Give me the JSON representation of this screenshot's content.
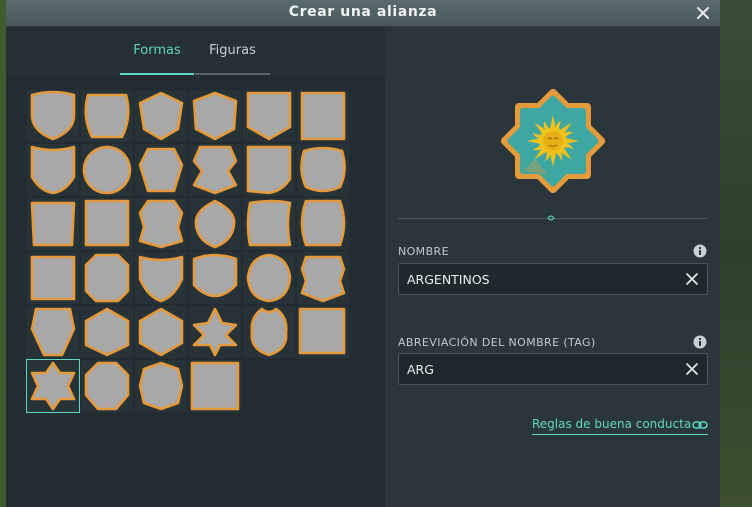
{
  "window": {
    "title": "Crear una alianza"
  },
  "tabs": [
    {
      "label": "Formas",
      "active": true
    },
    {
      "label": "Figuras",
      "active": false
    }
  ],
  "shapes": {
    "count": 34,
    "selected_index": 30,
    "rows": 6,
    "columns": 6
  },
  "emblem": {
    "name": "sun-star-emblem",
    "colors": {
      "border": "#e59a3b",
      "fill": "#3fa7a1",
      "sun": "#f1c21d"
    }
  },
  "form": {
    "name_label": "NOMBRE",
    "name_value": "ARGENTINOS",
    "tag_label": "ABREVIACIÓN DEL NOMBRE (TAG)",
    "tag_value": "ARG"
  },
  "rules_link": "Reglas de buena conducta",
  "colors": {
    "accent": "#5ed7c3",
    "shape_border": "#e49a3a",
    "shape_fill": "#a8a8a8"
  }
}
